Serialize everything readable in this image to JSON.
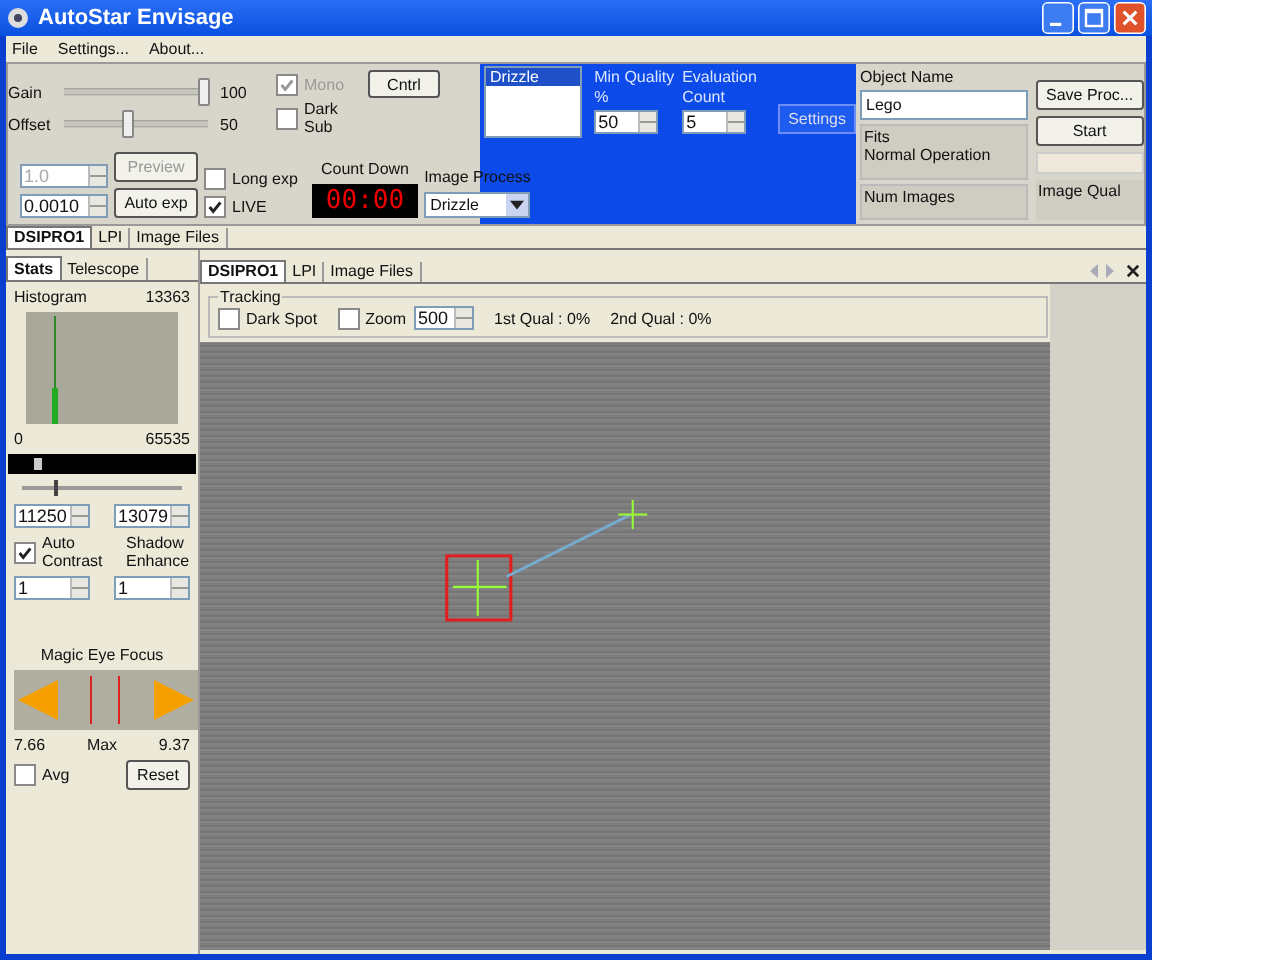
{
  "window": {
    "title": "AutoStar Envisage"
  },
  "menu": [
    "File",
    "Settings...",
    "About..."
  ],
  "camera": {
    "gain": {
      "label": "Gain",
      "value": "100",
      "level": 0.97
    },
    "offset": {
      "label": "Offset",
      "value": "50",
      "level": 0.45
    },
    "mono": {
      "label": "Mono",
      "checked": true,
      "disabled": true
    },
    "dark_sub": {
      "label": "Dark Sub",
      "checked": false
    },
    "exposure": {
      "value": "1.0",
      "disabled": true
    },
    "exposure_min": {
      "value": "0.0010",
      "disabled": false
    },
    "preview_button": {
      "label": "Preview",
      "disabled": true
    },
    "auto_exp_button": {
      "label": "Auto exp",
      "disabled": false
    },
    "long_exp": {
      "label": "Long exp",
      "checked": false
    },
    "live": {
      "label": "LIVE",
      "checked": true
    },
    "ctrl_button": "Cntrl",
    "countdown": {
      "label": "Count Down",
      "value": "00:00"
    },
    "image_process": {
      "label": "Image Process",
      "value": "Drizzle"
    }
  },
  "drizzle": {
    "items": [
      {
        "label": "Drizzle",
        "selected": true
      }
    ],
    "min_quality": {
      "label": "Min Quality %",
      "value": "50"
    },
    "evaluation_count": {
      "label": "Evaluation Count",
      "value": "5"
    },
    "settings_button": "Settings"
  },
  "object": {
    "label": "Object Name",
    "value": "Lego",
    "status_title": "Fits",
    "status_text": "Normal Operation",
    "num_images": "Num Images",
    "image_qual": "Image Qual",
    "save_button": "Save Proc...",
    "start_button": "Start"
  },
  "top_tabs": [
    {
      "label": "DSIPRO1",
      "selected": true
    },
    {
      "label": "LPI",
      "selected": false
    },
    {
      "label": "Image Files",
      "selected": false
    }
  ],
  "side_tabs": [
    {
      "label": "Stats",
      "selected": true
    },
    {
      "label": "Telescope",
      "selected": false
    }
  ],
  "stats": {
    "histogram_label": "Histogram",
    "histogram_value": "13363",
    "range_min": "0",
    "range_max": "65535",
    "range_slider": {
      "level": 0.14
    },
    "stretch_slider": {
      "level": 0.2
    },
    "low": "11250",
    "high": "13079",
    "auto_contrast": {
      "label": "Auto Contrast",
      "checked": true
    },
    "shadow_enhance": {
      "label": "Shadow Enhance"
    },
    "contrast_value": "1",
    "shadow_value": "1",
    "focus_label": "Magic Eye Focus",
    "focus_min": "7.66",
    "focus_max_label": "Max",
    "focus_max": "9.37",
    "avg": {
      "label": "Avg",
      "checked": false
    },
    "reset_button": "Reset"
  },
  "view_tabs": [
    {
      "label": "DSIPRO1",
      "selected": true
    },
    {
      "label": "LPI",
      "selected": false
    },
    {
      "label": "Image Files",
      "selected": false
    }
  ],
  "tracking": {
    "title": "Tracking",
    "dark_spot": {
      "label": "Dark Spot",
      "checked": false
    },
    "zoom": {
      "label": "Zoom",
      "checked": false
    },
    "zoom_value": "500",
    "first_qual": "1st Qual : 0%",
    "second_qual": "2nd Qual : 0%"
  }
}
